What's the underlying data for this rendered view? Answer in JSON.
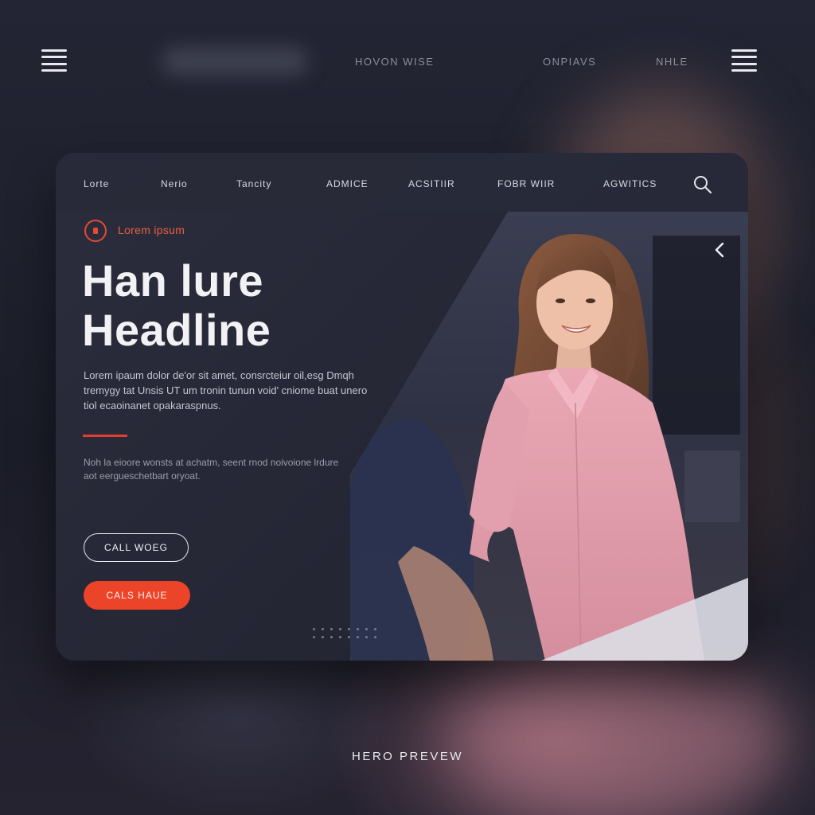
{
  "topbar": {
    "links": [
      "HOVON WISE",
      "ONPIAVS",
      "NHLE"
    ]
  },
  "card": {
    "nav": [
      "Lorte",
      "Nerio",
      "Tancity",
      "ADMICE",
      "ACSITIIR",
      "FOBR WIIR",
      "AGWITICS"
    ],
    "eyebrow": "Lorem ipsum",
    "headline": "Han lure Headline",
    "body1": "Lorem ipaum dolor de'or sit amet, consrcteiur oil,esg Dmqh tremygy tat Unsis UT um tronin tunun void' cniome buat unero tiol ecaoinanet opakaraspnus.",
    "body2": "Noh la eioore wonsts at achatm, seent rnod noivoione lrdure aot eergueschetbart oryoat.",
    "btn_outline": "CALL WOEG",
    "btn_solid": "CALS HAUE"
  },
  "caption": "HERO PREVEW",
  "colors": {
    "accent": "#ec4428",
    "card_bg": "#262836",
    "page_bg": "#1d1f2b"
  },
  "icons": [
    "hamburger-icon",
    "search-icon",
    "chevron-left-icon"
  ]
}
